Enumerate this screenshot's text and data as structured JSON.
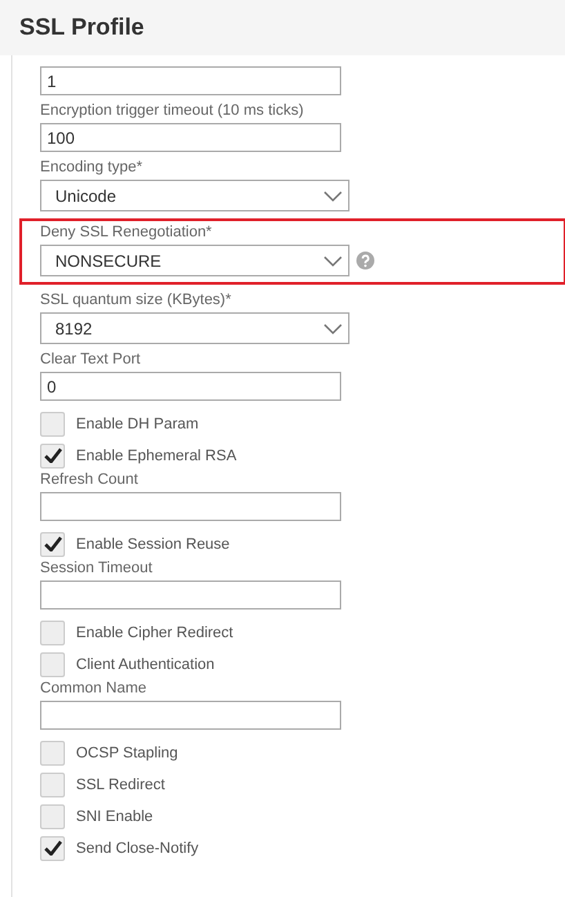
{
  "title": "SSL Profile",
  "fields": [
    {
      "kind": "text",
      "value": "1"
    },
    {
      "kind": "text",
      "label": "Encryption trigger timeout (10 ms ticks)",
      "value": "100"
    },
    {
      "kind": "select",
      "label": "Encoding type*",
      "value": "Unicode"
    },
    {
      "kind": "select",
      "label": "Deny SSL Renegotiation*",
      "value": "NONSECURE",
      "highlighted": true,
      "help": true
    },
    {
      "kind": "select",
      "label": "SSL quantum size (KBytes)*",
      "value": "8192"
    },
    {
      "kind": "text",
      "label": "Clear Text Port",
      "value": "0"
    },
    {
      "kind": "checkbox",
      "label": "Enable DH Param",
      "checked": false
    },
    {
      "kind": "checkbox",
      "label": "Enable Ephemeral RSA",
      "checked": true
    },
    {
      "kind": "text",
      "label": "Refresh Count"
    },
    {
      "kind": "checkbox",
      "label": "Enable Session Reuse",
      "checked": true
    },
    {
      "kind": "text",
      "label": "Session Timeout"
    },
    {
      "kind": "checkbox",
      "label": "Enable Cipher Redirect",
      "checked": false
    },
    {
      "kind": "checkbox",
      "label": "Client Authentication",
      "checked": false
    },
    {
      "kind": "text",
      "label": "Common Name"
    },
    {
      "kind": "checkbox",
      "label": "OCSP Stapling",
      "checked": false
    },
    {
      "kind": "checkbox",
      "label": "SSL Redirect",
      "checked": false
    },
    {
      "kind": "checkbox",
      "label": "SNI Enable",
      "checked": false
    },
    {
      "kind": "checkbox",
      "label": "Send Close-Notify",
      "checked": true
    }
  ]
}
